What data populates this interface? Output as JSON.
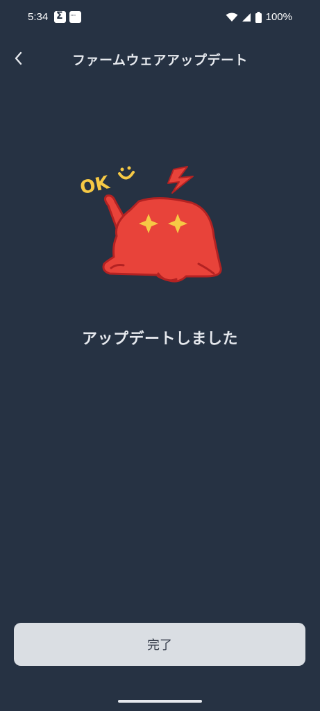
{
  "status_bar": {
    "time": "5:34",
    "battery_percent": "100%",
    "icons": [
      "sigma-app-icon",
      "dots-app-icon",
      "wifi-icon",
      "signal-icon",
      "battery-icon"
    ]
  },
  "header": {
    "back_icon": "chevron-left-icon",
    "title": "ファームウェアアップデート"
  },
  "illustration": {
    "badge_text": "OK",
    "character": "red-bear-lying-down"
  },
  "main": {
    "message": "アップデートしました"
  },
  "footer": {
    "done_label": "完了"
  },
  "colors": {
    "background": "#263243",
    "button_background": "#dadee3",
    "character_red": "#e8433a",
    "accent_yellow": "#f6c945"
  }
}
